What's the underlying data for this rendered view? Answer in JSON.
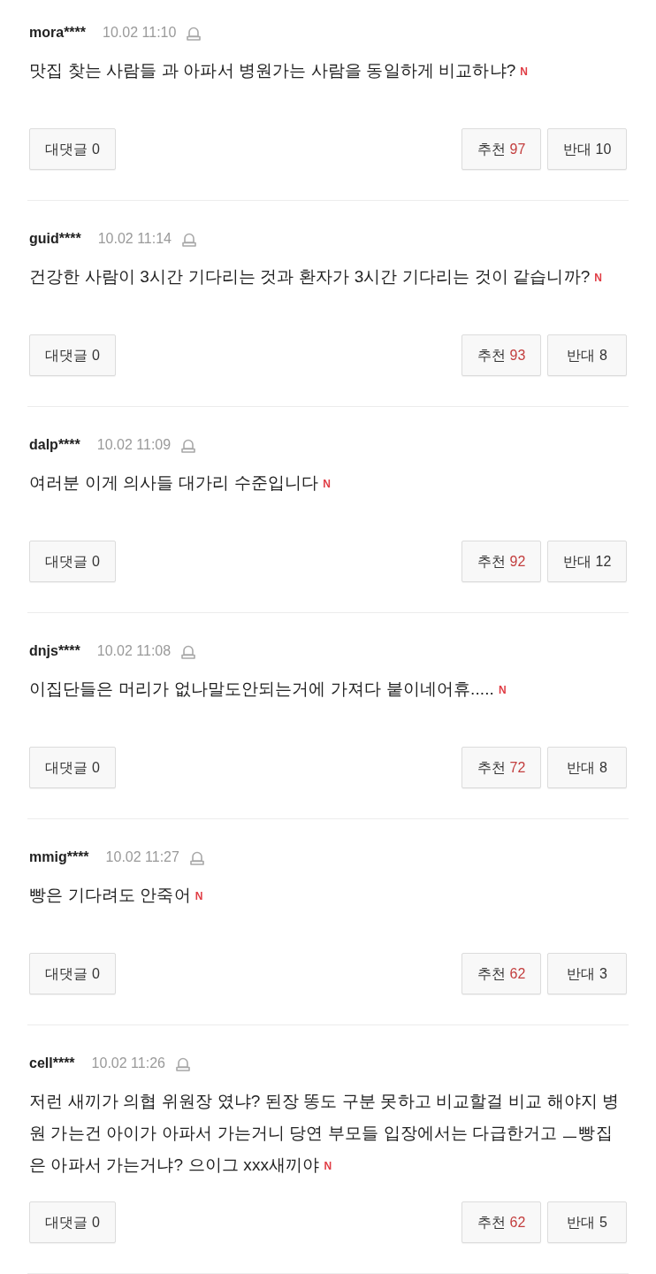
{
  "comments": [
    {
      "user": "mora****",
      "time": "10.02 11:10",
      "text": "맛집 찾는 사람들 과 아파서 병원가는 사람을 동일하게 비교하냐?",
      "new_mark": "N",
      "reply_button": {
        "label": "대댓글",
        "count": "0"
      },
      "like_button": {
        "label": "추천",
        "count": "97"
      },
      "dislike_button": {
        "label": "반대",
        "count": "10"
      }
    },
    {
      "user": "guid****",
      "time": "10.02 11:14",
      "text": "건강한 사람이 3시간 기다리는 것과 환자가 3시간 기다리는 것이 같습니까?",
      "new_mark": "N",
      "reply_button": {
        "label": "대댓글",
        "count": "0"
      },
      "like_button": {
        "label": "추천",
        "count": "93"
      },
      "dislike_button": {
        "label": "반대",
        "count": "8"
      }
    },
    {
      "user": "dalp****",
      "time": "10.02 11:09",
      "text": "여러분 이게 의사들 대가리 수준입니다",
      "new_mark": "N",
      "reply_button": {
        "label": "대댓글",
        "count": "0"
      },
      "like_button": {
        "label": "추천",
        "count": "92"
      },
      "dislike_button": {
        "label": "반대",
        "count": "12"
      }
    },
    {
      "user": "dnjs****",
      "time": "10.02 11:08",
      "text": "이집단들은 머리가 없나말도안되는거에 가져다 붙이네어휴.....",
      "new_mark": "N",
      "reply_button": {
        "label": "대댓글",
        "count": "0"
      },
      "like_button": {
        "label": "추천",
        "count": "72"
      },
      "dislike_button": {
        "label": "반대",
        "count": "8"
      }
    },
    {
      "user": "mmig****",
      "time": "10.02 11:27",
      "text": "빵은 기다려도 안죽어",
      "new_mark": "N",
      "reply_button": {
        "label": "대댓글",
        "count": "0"
      },
      "like_button": {
        "label": "추천",
        "count": "62"
      },
      "dislike_button": {
        "label": "반대",
        "count": "3"
      }
    },
    {
      "user": "cell****",
      "time": "10.02 11:26",
      "text": "저런 새끼가 의협 위원장 였냐? 된장 똥도 구분 못하고 비교할걸 비교 해야지 병원 가는건 아이가 아파서 가는거니 당연 부모들 입장에서는 다급한거고 ㅡ빵집은 아파서 가는거냐? 으이그 xxx새끼야",
      "new_mark": "N",
      "reply_button": {
        "label": "대댓글",
        "count": "0"
      },
      "like_button": {
        "label": "추천",
        "count": "62"
      },
      "dislike_button": {
        "label": "반대",
        "count": "5"
      }
    }
  ]
}
